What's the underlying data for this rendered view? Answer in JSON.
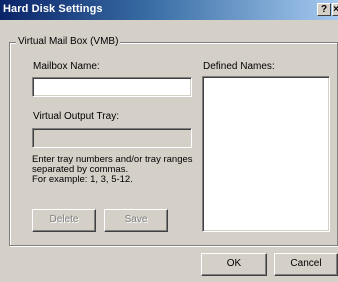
{
  "window": {
    "title": "Hard Disk Settings",
    "help_glyph": "?",
    "close_glyph": "×"
  },
  "group": {
    "title": "Virtual Mail Box (VMB)"
  },
  "mailbox": {
    "label": "Mailbox Name:",
    "value": ""
  },
  "defined_names": {
    "label": "Defined Names:",
    "items": []
  },
  "output_tray": {
    "label": "Virtual Output Tray:",
    "value": ""
  },
  "help": {
    "line1": "Enter tray numbers and/or tray ranges",
    "line2": "separated by commas.",
    "line3": "For example: 1, 3, 5-12."
  },
  "buttons": {
    "delete": {
      "label": "Delete",
      "enabled": false
    },
    "save": {
      "label": "Save",
      "enabled": false
    },
    "ok": {
      "label": "OK",
      "enabled": true
    },
    "cancel": {
      "label": "Cancel",
      "enabled": true
    }
  }
}
